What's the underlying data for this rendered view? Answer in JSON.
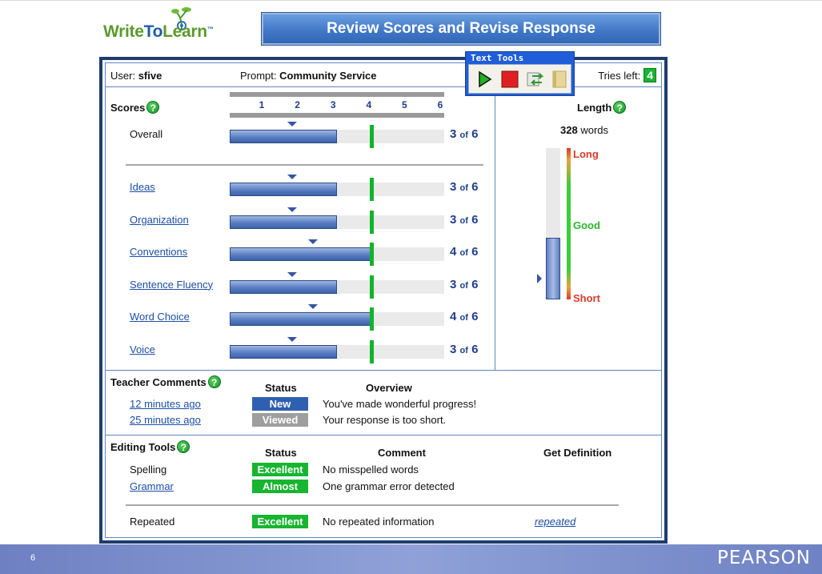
{
  "logo": {
    "text_write": "Write",
    "text_to": "To",
    "text_learn": "Learn",
    "tm": "™"
  },
  "title": "Review Scores and Revise Response",
  "userbar": {
    "user_label": "User:",
    "user_name": "sfive",
    "prompt_label": "Prompt:",
    "prompt_name": "Community Service",
    "tries_label": "Tries left:",
    "tries_value": "4"
  },
  "text_tools": {
    "title": "Text Tools"
  },
  "scores": {
    "title": "Scores",
    "scale": [
      "1",
      "2",
      "3",
      "4",
      "5",
      "6"
    ],
    "of_label": "of",
    "max": "6",
    "overall": {
      "label": "Overall",
      "score": "3",
      "fraction": 0.5
    },
    "traits": [
      {
        "label": "Ideas",
        "score": "3",
        "fraction": 0.5
      },
      {
        "label": "Organization",
        "score": "3",
        "fraction": 0.5
      },
      {
        "label": "Conventions",
        "score": "4",
        "fraction": 0.667
      },
      {
        "label": "Sentence Fluency",
        "score": "3",
        "fraction": 0.5
      },
      {
        "label": "Word Choice",
        "score": "4",
        "fraction": 0.667
      },
      {
        "label": "Voice",
        "score": "3",
        "fraction": 0.5
      }
    ],
    "target_score": 4
  },
  "length": {
    "title": "Length",
    "words_value": "328",
    "words_label": "words",
    "long_label": "Long",
    "good_label": "Good",
    "short_label": "Short",
    "fill_fraction": 0.41,
    "pointer_fraction": 0.14
  },
  "comments": {
    "title": "Teacher Comments",
    "status_header": "Status",
    "overview_header": "Overview",
    "rows": [
      {
        "time": "12 minutes ago",
        "status": "New",
        "status_color": "#2f5fb0",
        "overview": "You've made wonderful progress!"
      },
      {
        "time": "25 minutes ago",
        "status": "Viewed",
        "status_color": "#9e9e9e",
        "overview": "Your response is too short."
      }
    ]
  },
  "editing": {
    "title": "Editing Tools",
    "status_header": "Status",
    "comment_header": "Comment",
    "definition_header": "Get Definition",
    "rows": [
      {
        "tool": "Spelling",
        "status": "Excellent",
        "status_color": "#17b530",
        "comment": "No misspelled words"
      },
      {
        "tool": "Grammar",
        "status": "Almost",
        "status_color": "#17b530",
        "comment": "One grammar error detected"
      },
      {
        "tool": "Repeated",
        "status": "Excellent",
        "status_color": "#17b530",
        "comment": "No repeated information",
        "definition": "repeated"
      }
    ]
  },
  "footer": {
    "page_number": "6",
    "brand": "PEARSON"
  },
  "colors": {
    "accent_blue": "#3f76c6",
    "frame": "#1e3d6e",
    "target_green": "#13b32a",
    "score_text": "#1f3f8a"
  }
}
